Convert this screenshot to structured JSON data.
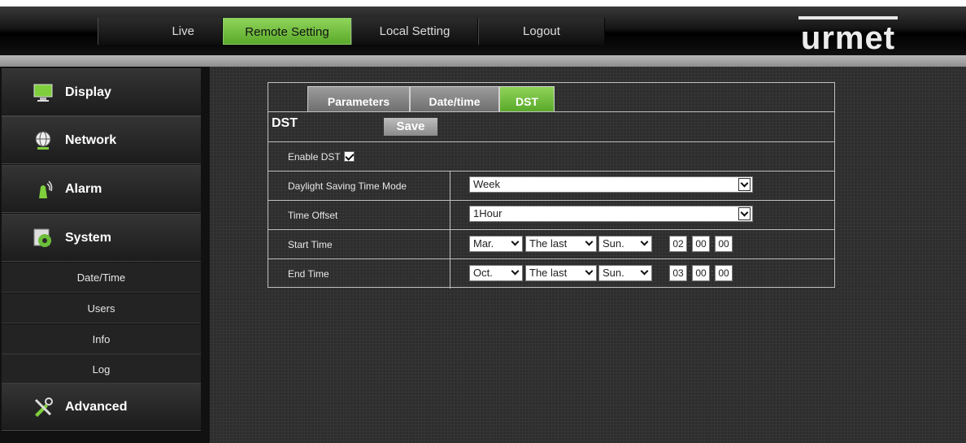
{
  "nav": {
    "live": "Live",
    "remote": "Remote Setting",
    "local": "Local Setting",
    "logout": "Logout"
  },
  "brand": {
    "logo": "urmet",
    "accent": "#6cbf3a"
  },
  "sidebar": {
    "display": "Display",
    "network": "Network",
    "alarm": "Alarm",
    "system": "System",
    "sub": [
      "Date/Time",
      "Users",
      "Info",
      "Log"
    ],
    "advanced": "Advanced",
    "icons": [
      "monitor-icon",
      "globe-icon",
      "alarm-icon",
      "system-icon",
      "tools-icon"
    ]
  },
  "tabs": [
    "Parameters",
    "Date/time",
    "DST"
  ],
  "dst": {
    "title": "DST",
    "save": "Save",
    "enable_label": "Enable DST",
    "enable_checked": true,
    "mode_label": "Daylight Saving Time Mode",
    "mode_value": "Week",
    "offset_label": "Time Offset",
    "offset_value": "1Hour",
    "start_label": "Start Time",
    "start": {
      "month": "Mar.",
      "week": "The last",
      "day": "Sun.",
      "hh": "02",
      "mm": "00",
      "ss": "00"
    },
    "end_label": "End Time",
    "end": {
      "month": "Oct.",
      "week": "The last",
      "day": "Sun.",
      "hh": "03",
      "mm": "00",
      "ss": "00"
    }
  }
}
